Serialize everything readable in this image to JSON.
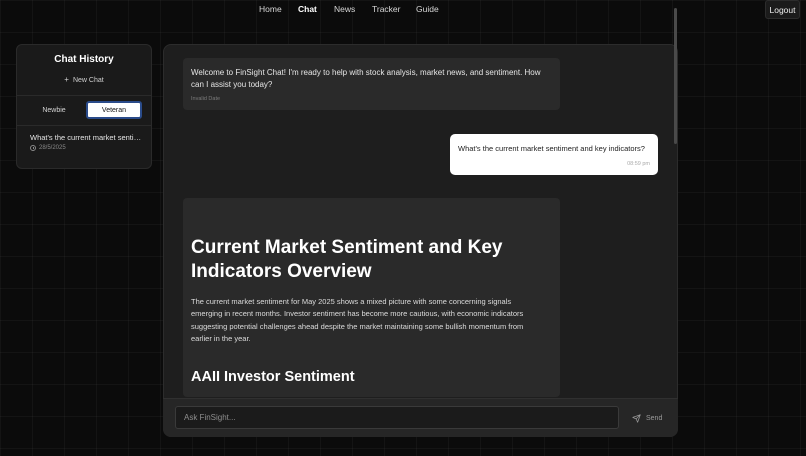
{
  "nav": {
    "items": [
      {
        "label": "Home",
        "active": false
      },
      {
        "label": "Chat",
        "active": true
      },
      {
        "label": "News",
        "active": false
      },
      {
        "label": "Tracker",
        "active": false
      },
      {
        "label": "Guide",
        "active": false
      }
    ],
    "logout_label": "Logout"
  },
  "sidebar": {
    "title": "Chat History",
    "new_chat_label": "New Chat",
    "modes": {
      "newbie": "Newbie",
      "veteran": "Veteran",
      "selected": "Veteran"
    },
    "history": [
      {
        "title": "What's the current market sentiment and key indicators?",
        "date": "28/5/2025"
      }
    ]
  },
  "chat": {
    "welcome": {
      "text": "Welcome to FinSight Chat! I'm ready to help with stock analysis, market news, and sentiment. How can I assist you today?",
      "timestamp": "Invalid Date"
    },
    "user_message": {
      "text": "What's the current market sentiment and key indicators?",
      "timestamp": "08:59 pm"
    },
    "answer": {
      "heading": "Current Market Sentiment and Key Indicators Overview",
      "paragraph": "The current market sentiment for May 2025 shows a mixed picture with some concerning signals emerging in recent months. Investor sentiment has become more cautious, with economic indicators suggesting potential challenges ahead despite the market maintaining some bullish momentum from earlier in the year.",
      "subheading": "AAII Investor Sentiment"
    }
  },
  "input": {
    "placeholder": "Ask FinSight...",
    "send_label": "Send"
  },
  "colors": {
    "background": "#0b0b0b",
    "panel": "#1e1e1e",
    "bot_bubble": "#2a2a2a",
    "user_bubble": "#ffffff",
    "toggle_border": "#2a4b8a"
  },
  "icons": {
    "new_chat": "plus-icon",
    "history_date": "clock-icon",
    "send": "send-icon"
  }
}
